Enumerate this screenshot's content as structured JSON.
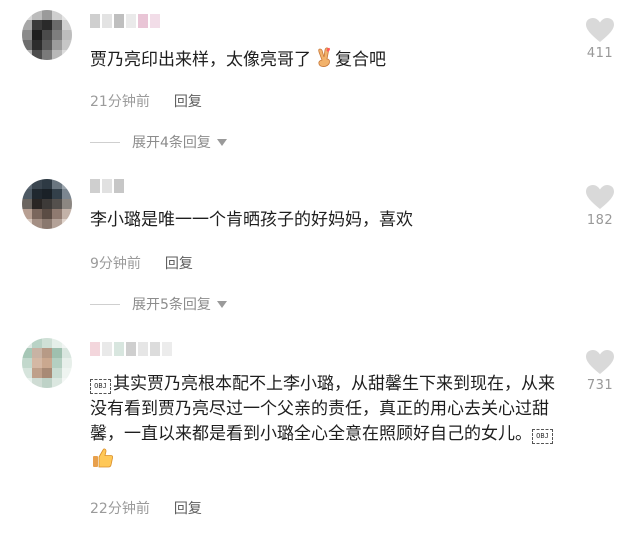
{
  "comments": [
    {
      "text": "贾乃亮印出来样，太像亮哥了",
      "text_after": "复合吧",
      "emoji": "finger-heart-icon",
      "time": "21分钟前",
      "reply_label": "回复",
      "expand_label": "展开4条回复",
      "likes": "411"
    },
    {
      "text": "李小璐是唯一一个肯晒孩子的好妈妈，喜欢",
      "time": "9分钟前",
      "reply_label": "回复",
      "expand_label": "展开5条回复",
      "likes": "182"
    },
    {
      "obj_glyph": "OBJ",
      "text": "其实贾乃亮根本配不上李小璐，从甜馨生下来到现在，从来没有看到贾乃亮尽过一个父亲的责任，真正的用心去关心过甜馨，一直以来都是看到小璐全心全意在照顾好自己的女儿。",
      "emoji": "thumbs-up-icon",
      "time": "22分钟前",
      "reply_label": "回复",
      "likes": "731"
    }
  ],
  "colors": {
    "heart": "#d9d9d9",
    "meta_text": "#9b9b9b",
    "expand_text": "#8c8c8c"
  }
}
